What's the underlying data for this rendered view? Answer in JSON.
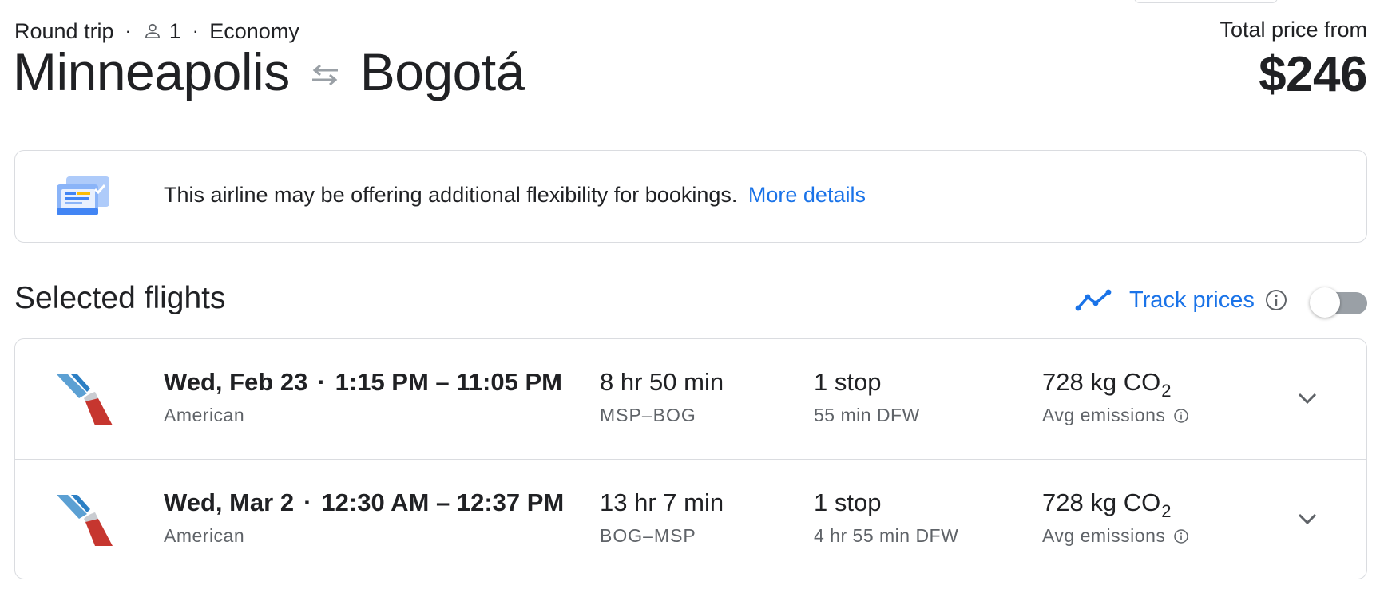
{
  "header": {
    "trip_type": "Round trip",
    "passengers": "1",
    "cabin": "Economy",
    "origin": "Minneapolis",
    "destination": "Bogotá",
    "price_label": "Total price from",
    "price": "$246"
  },
  "banner": {
    "message": "This airline may be offering additional flexibility for bookings.",
    "link": "More details"
  },
  "selected": {
    "title": "Selected flights",
    "track_label": "Track prices",
    "track_enabled": false
  },
  "flights": [
    {
      "date": "Wed, Feb 23",
      "times": "1:15 PM – 11:05 PM",
      "airline": "American",
      "duration": "8 hr 50 min",
      "route": "MSP–BOG",
      "stops": "1 stop",
      "layover": "55 min DFW",
      "co2_value": "728 kg CO",
      "co2_sub": "2",
      "emissions": "Avg emissions"
    },
    {
      "date": "Wed, Mar 2",
      "times": "12:30 AM – 12:37 PM",
      "airline": "American",
      "duration": "13 hr 7 min",
      "route": "BOG–MSP",
      "stops": "1 stop",
      "layover": "4 hr 55 min DFW",
      "co2_value": "728 kg CO",
      "co2_sub": "2",
      "emissions": "Avg emissions"
    }
  ],
  "colors": {
    "link": "#1a73e8",
    "text": "#202124",
    "secondary": "#5f6368",
    "border": "#dadce0",
    "airline_blue": "#5ca0d3",
    "airline_red": "#c6362f"
  },
  "icons": {
    "person": "person-icon",
    "swap": "swap-arrows-icon",
    "ticket": "ticket-check-icon",
    "trend": "trend-line-icon",
    "info": "info-icon",
    "chevron": "chevron-down-icon",
    "airline_logo": "american-airlines-logo-icon"
  }
}
